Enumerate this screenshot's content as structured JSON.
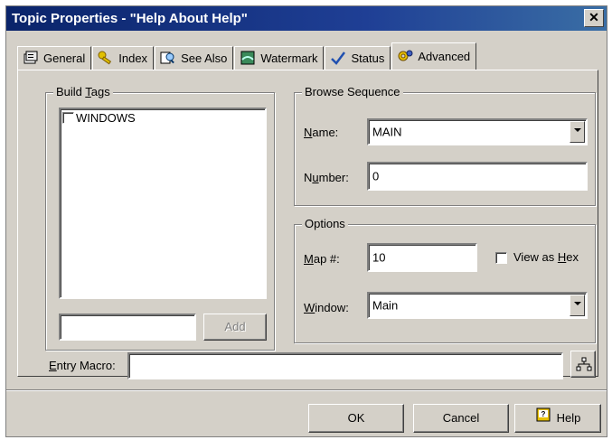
{
  "window": {
    "title": "Topic Properties - \"Help About Help\"",
    "close_glyph": "✕"
  },
  "tabs": [
    {
      "label": "General",
      "icon": "general-properties-icon"
    },
    {
      "label": "Index",
      "icon": "keys-icon"
    },
    {
      "label": "See Also",
      "icon": "see-also-icon"
    },
    {
      "label": "Watermark",
      "icon": "watermark-icon"
    },
    {
      "label": "Status",
      "icon": "checkmark-icon"
    },
    {
      "label": "Advanced",
      "icon": "advanced-icon"
    }
  ],
  "build_tags": {
    "title_pre": "Build ",
    "title_u": "T",
    "title_post": "ags",
    "items": [
      {
        "label": "WINDOWS",
        "checked": false
      }
    ],
    "add_input_value": "",
    "add_button": "Add"
  },
  "browse_sequence": {
    "title": "Browse Sequence",
    "name_label_u": "N",
    "name_label_rest": "ame:",
    "name_value": "MAIN",
    "number_label_pre": "N",
    "number_label_u": "u",
    "number_label_rest": "mber:",
    "number_value": "0"
  },
  "options": {
    "title": "Options",
    "map_label_u": "M",
    "map_label_rest": "ap #:",
    "map_value": "10",
    "view_hex_pre": "View as ",
    "view_hex_u": "H",
    "view_hex_post": "ex",
    "view_hex_checked": false,
    "window_label_u": "W",
    "window_label_rest": "indow:",
    "window_value": "Main"
  },
  "entry_macro": {
    "label_u": "E",
    "label_rest": "ntry Macro:",
    "value": ""
  },
  "buttons": {
    "ok": "OK",
    "cancel": "Cancel",
    "help": "Help"
  },
  "colors": {
    "title_bar": "#0a246a",
    "face": "#d4d0c8"
  }
}
